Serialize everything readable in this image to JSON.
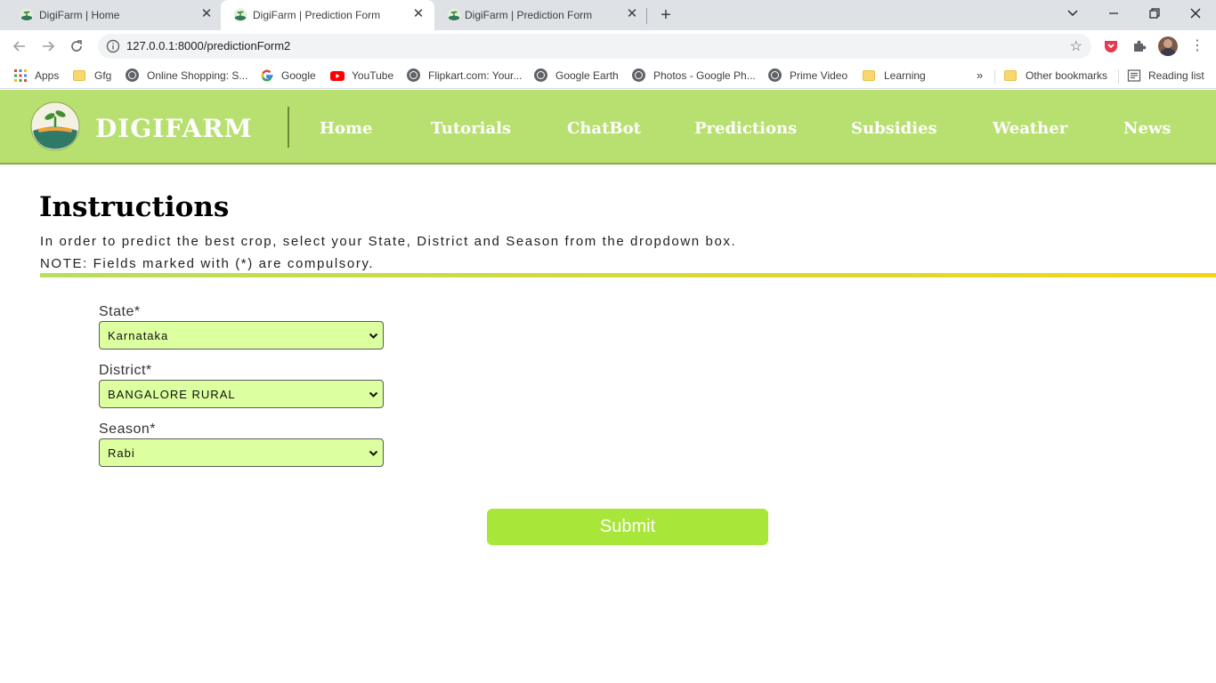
{
  "browser": {
    "tabs": [
      {
        "title": "DigiFarm | Home",
        "active": false
      },
      {
        "title": "DigiFarm | Prediction Form",
        "active": true
      },
      {
        "title": "DigiFarm | Prediction Form",
        "active": false
      }
    ],
    "url": "127.0.0.1:8000/predictionForm2",
    "bookmarks": [
      {
        "label": "Apps",
        "icon": "apps-grid-icon"
      },
      {
        "label": "Gfg",
        "icon": "folder-icon"
      },
      {
        "label": "Online Shopping: S...",
        "icon": "globe-icon"
      },
      {
        "label": "Google",
        "icon": "google-icon"
      },
      {
        "label": "YouTube",
        "icon": "youtube-icon"
      },
      {
        "label": "Flipkart.com: Your...",
        "icon": "globe-icon"
      },
      {
        "label": "Google Earth",
        "icon": "globe-icon"
      },
      {
        "label": "Photos - Google Ph...",
        "icon": "globe-icon"
      },
      {
        "label": "Prime Video",
        "icon": "globe-icon"
      },
      {
        "label": "Learning",
        "icon": "folder-icon"
      },
      {
        "label": "Other bookmarks",
        "icon": "folder-icon"
      },
      {
        "label": "Reading list",
        "icon": "reading-list-icon"
      }
    ],
    "overflow_label": "»"
  },
  "site": {
    "brand": "DIGIFARM",
    "nav": [
      "Home",
      "Tutorials",
      "ChatBot",
      "Predictions",
      "Subsidies",
      "Weather",
      "News"
    ],
    "colors": {
      "header": "#b8e070",
      "field": "#dcff9f",
      "submit": "#a8e639"
    }
  },
  "instructions": {
    "title": "Instructions",
    "line1": "In order to predict the best crop, select your State, District and Season from the dropdown box.",
    "line2": "NOTE: Fields marked with (*) are compulsory."
  },
  "form": {
    "state": {
      "label": "State*",
      "value": "Karnataka"
    },
    "district": {
      "label": "District*",
      "value": "BANGALORE RURAL"
    },
    "season": {
      "label": "Season*",
      "value": "Rabi"
    },
    "submit_label": "Submit"
  }
}
